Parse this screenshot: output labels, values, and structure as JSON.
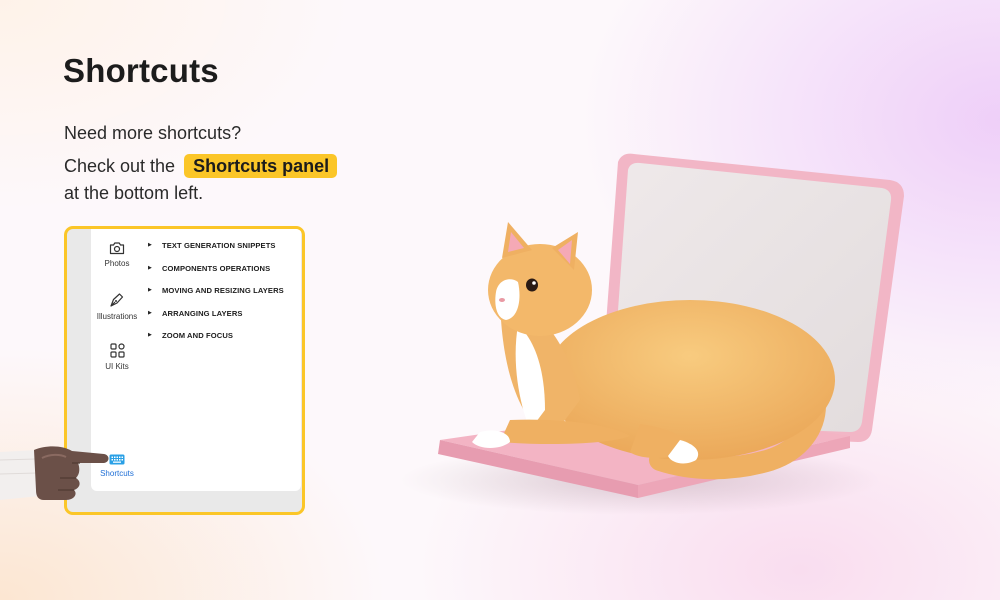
{
  "title": "Shortcuts",
  "intro": {
    "line1": "Need more shortcuts?",
    "line2_prefix": "Check out the",
    "highlight": "Shortcuts panel",
    "line3": "at the bottom left."
  },
  "panel": {
    "rail": [
      {
        "label": "Photos",
        "icon": "camera-icon"
      },
      {
        "label": "Illustrations",
        "icon": "pen-tool-icon"
      },
      {
        "label": "UI Kits",
        "icon": "grid-icon"
      }
    ],
    "shortcuts_button": {
      "label": "Shortcuts",
      "icon": "keyboard-icon"
    },
    "shortcut_categories": [
      "TEXT GENERATION SNIPPETS",
      "COMPONENTS OPERATIONS",
      "MOVING AND RESIZING LAYERS",
      "ARRANGING LAYERS",
      "ZOOM AND FOCUS"
    ]
  },
  "colors": {
    "accent": "#fbc628",
    "active_blue": "#1f6fd6",
    "title_text": "#1c1c1c",
    "cat_body": "#f2b866",
    "laptop_pink": "#f3b8c8"
  }
}
